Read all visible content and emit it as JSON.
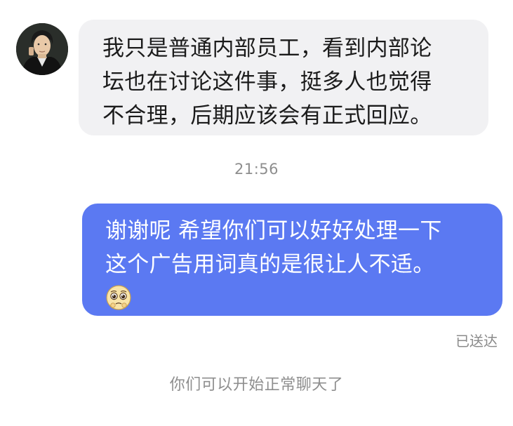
{
  "chat": {
    "incoming": {
      "avatar_icon": "contact-avatar",
      "lines": [
        "我只是普通内部员工，看到内部论",
        "坛也在讨论这件事，挺多人也觉得",
        "不合理，后期应该会有正式回应。"
      ]
    },
    "timestamp": "21:56",
    "outgoing": {
      "lines": [
        "谢谢呢 希望你们可以好好处理一下",
        "这个广告用词真的是很让人不适。"
      ],
      "emoji_icon": "pleading-face-emoji",
      "status": "已送达"
    },
    "system_note": "你们可以开始正常聊天了"
  },
  "colors": {
    "incoming_bubble": "#f1f1f3",
    "outgoing_bubble": "#5b79f2",
    "muted_text": "#8e8e8e"
  }
}
